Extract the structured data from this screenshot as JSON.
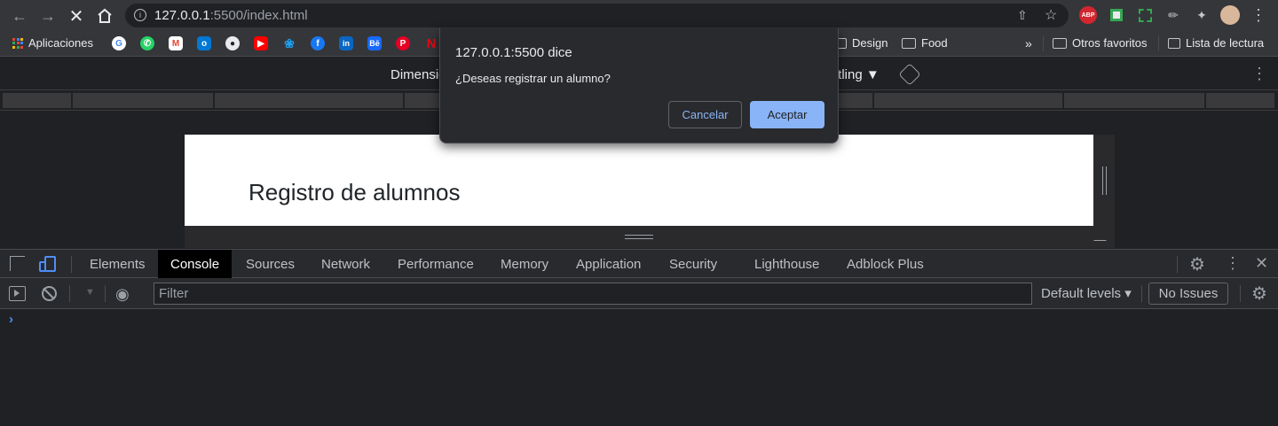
{
  "browser": {
    "url_host": "127.0.0.1",
    "url_rest": ":5500/index.html",
    "bookmarks": {
      "apps_label": "Aplicaciones",
      "design_label": "Design",
      "food_label": "Food",
      "more_label": "»",
      "other_favorites_label": "Otros favoritos",
      "reading_list_label": "Lista de lectura"
    },
    "extensions": {
      "abp_label": "ABP"
    }
  },
  "device_toolbar": {
    "dimensions_label": "Dimensio",
    "throttling_label": "ttling ▼"
  },
  "page": {
    "heading": "Registro de alumnos"
  },
  "dialog": {
    "title": "127.0.0.1:5500 dice",
    "message": "¿Deseas registrar un alumno?",
    "cancel_label": "Cancelar",
    "accept_label": "Aceptar"
  },
  "devtools": {
    "tabs": [
      "Elements",
      "Console",
      "Sources",
      "Network",
      "Performance",
      "Memory",
      "Application",
      "Security",
      "Lighthouse",
      "Adblock Plus"
    ],
    "active_tab": "Console",
    "filter_placeholder": "Filter",
    "levels_label": "Default levels ▾",
    "issues_label": "No Issues",
    "prompt": "›"
  }
}
